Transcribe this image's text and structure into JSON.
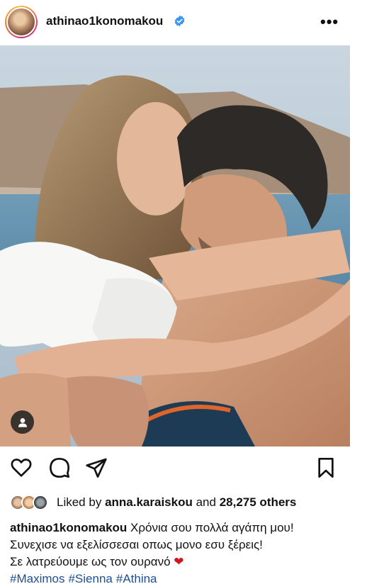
{
  "post": {
    "username": "athinao1konomakou",
    "more_label": "•••"
  },
  "icons": {
    "verified": "verified-badge-icon",
    "tag": "user-tag-icon",
    "like": "heart-outline-icon",
    "comment": "comment-bubble-icon",
    "share": "paper-plane-icon",
    "save": "bookmark-icon"
  },
  "likes": {
    "prefix": "Liked by",
    "user": "anna.karaiskou",
    "middle": "and",
    "count": "28,275 others"
  },
  "caption": {
    "username": "athinao1konomakou",
    "line1": "Χρόνια σου πολλά αγάπη μου!",
    "line2": "Συνεχισε να εξελίσσεσαι οπως μονο εσυ ξέρεις!",
    "line3": "Σε λατρεύουμε ως τον ουρανό",
    "heart": "❤",
    "hashtags": [
      "#Maximos",
      "#Sienna",
      "#Athina"
    ]
  },
  "colors": {
    "verified_blue": "#3897f0",
    "hashtag_blue": "#1d4f91",
    "heart_red": "#d0161c"
  }
}
